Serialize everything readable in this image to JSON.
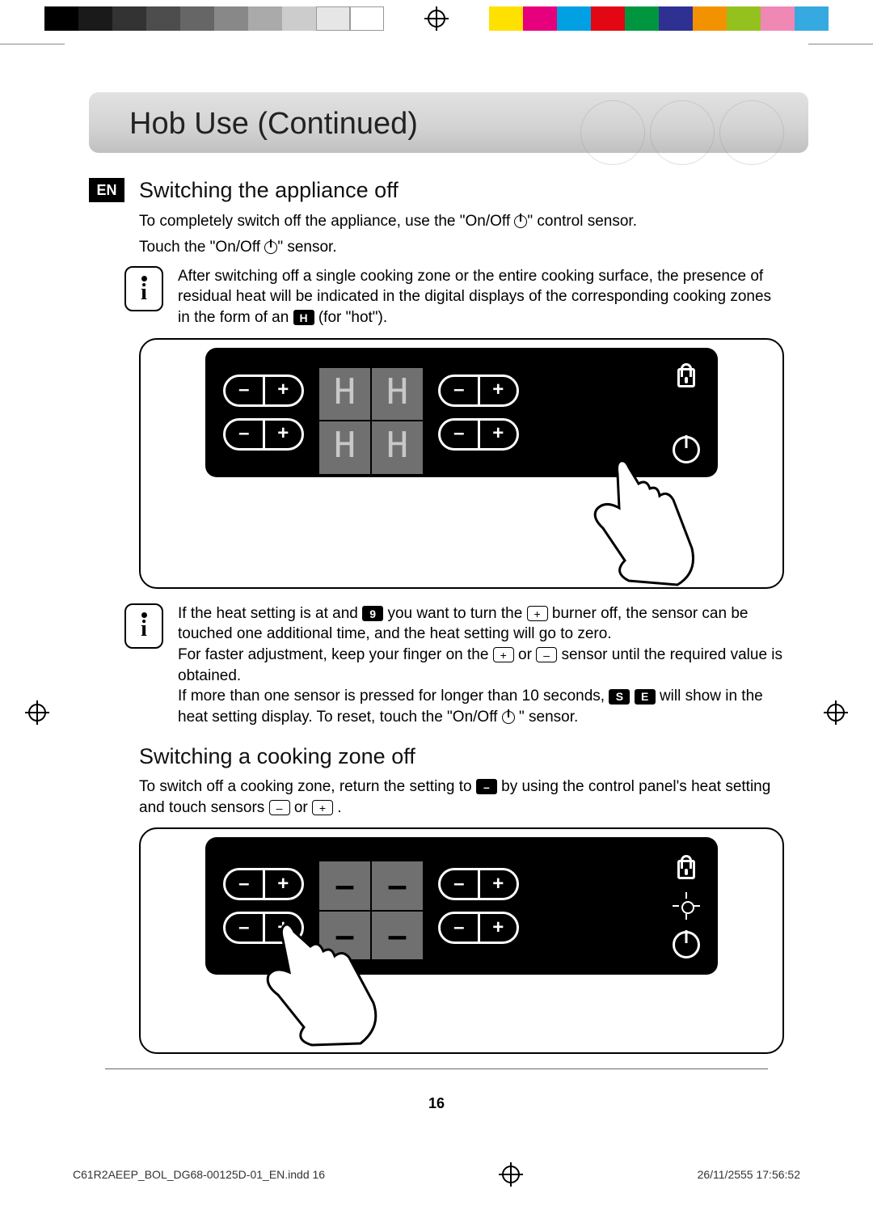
{
  "header": {
    "title": "Hob Use (Continued)"
  },
  "lang_tag": "EN",
  "section1": {
    "heading": "Switching the appliance off",
    "p1a": "To completely switch off the appliance, use the \"On/Off ",
    "p1b": "\" control sensor.",
    "p2a": "Touch the \"On/Off ",
    "p2b": "\" sensor.",
    "note1a": "After switching off a single cooking zone or the entire cooking surface, the presence of residual heat will be indicated in the digital displays of the corresponding cooking zones in the form of an ",
    "note1_H": "H",
    "note1b": " (for \"hot\").",
    "note2a": "If the heat setting is at and ",
    "note2_q": "9",
    "note2b": " you want to turn the ",
    "note2c": " burner off, the sensor can be touched one additional time, and the heat setting will go to zero.",
    "note3a": "For faster adjustment, keep your finger on the ",
    "note3b": " or ",
    "note3c": " sensor until the required value is obtained.",
    "note4a": "If more than one sensor is pressed for longer than 10 seconds, ",
    "note4_se1": "S",
    "note4_se2": "E",
    "note4b": " will show in the heat setting display. To reset, touch the \"On/Off ",
    "note4c": "\" sensor."
  },
  "section2": {
    "heading": "Switching a cooking zone off",
    "p1a": "To switch off a cooking zone, return the setting to ",
    "p1_dash": "–",
    "p1b": " by using the control panel's heat setting and touch sensors ",
    "p1c": " or ",
    "p1d": "."
  },
  "panel": {
    "minus": "–",
    "plus": "+",
    "disp1": "H",
    "disp2": "–"
  },
  "page_number": "16",
  "footer": {
    "file": "C61R2AEEP_BOL_DG68-00125D-01_EN.indd   16",
    "datetime": "26/11/2555   17:56:52"
  }
}
